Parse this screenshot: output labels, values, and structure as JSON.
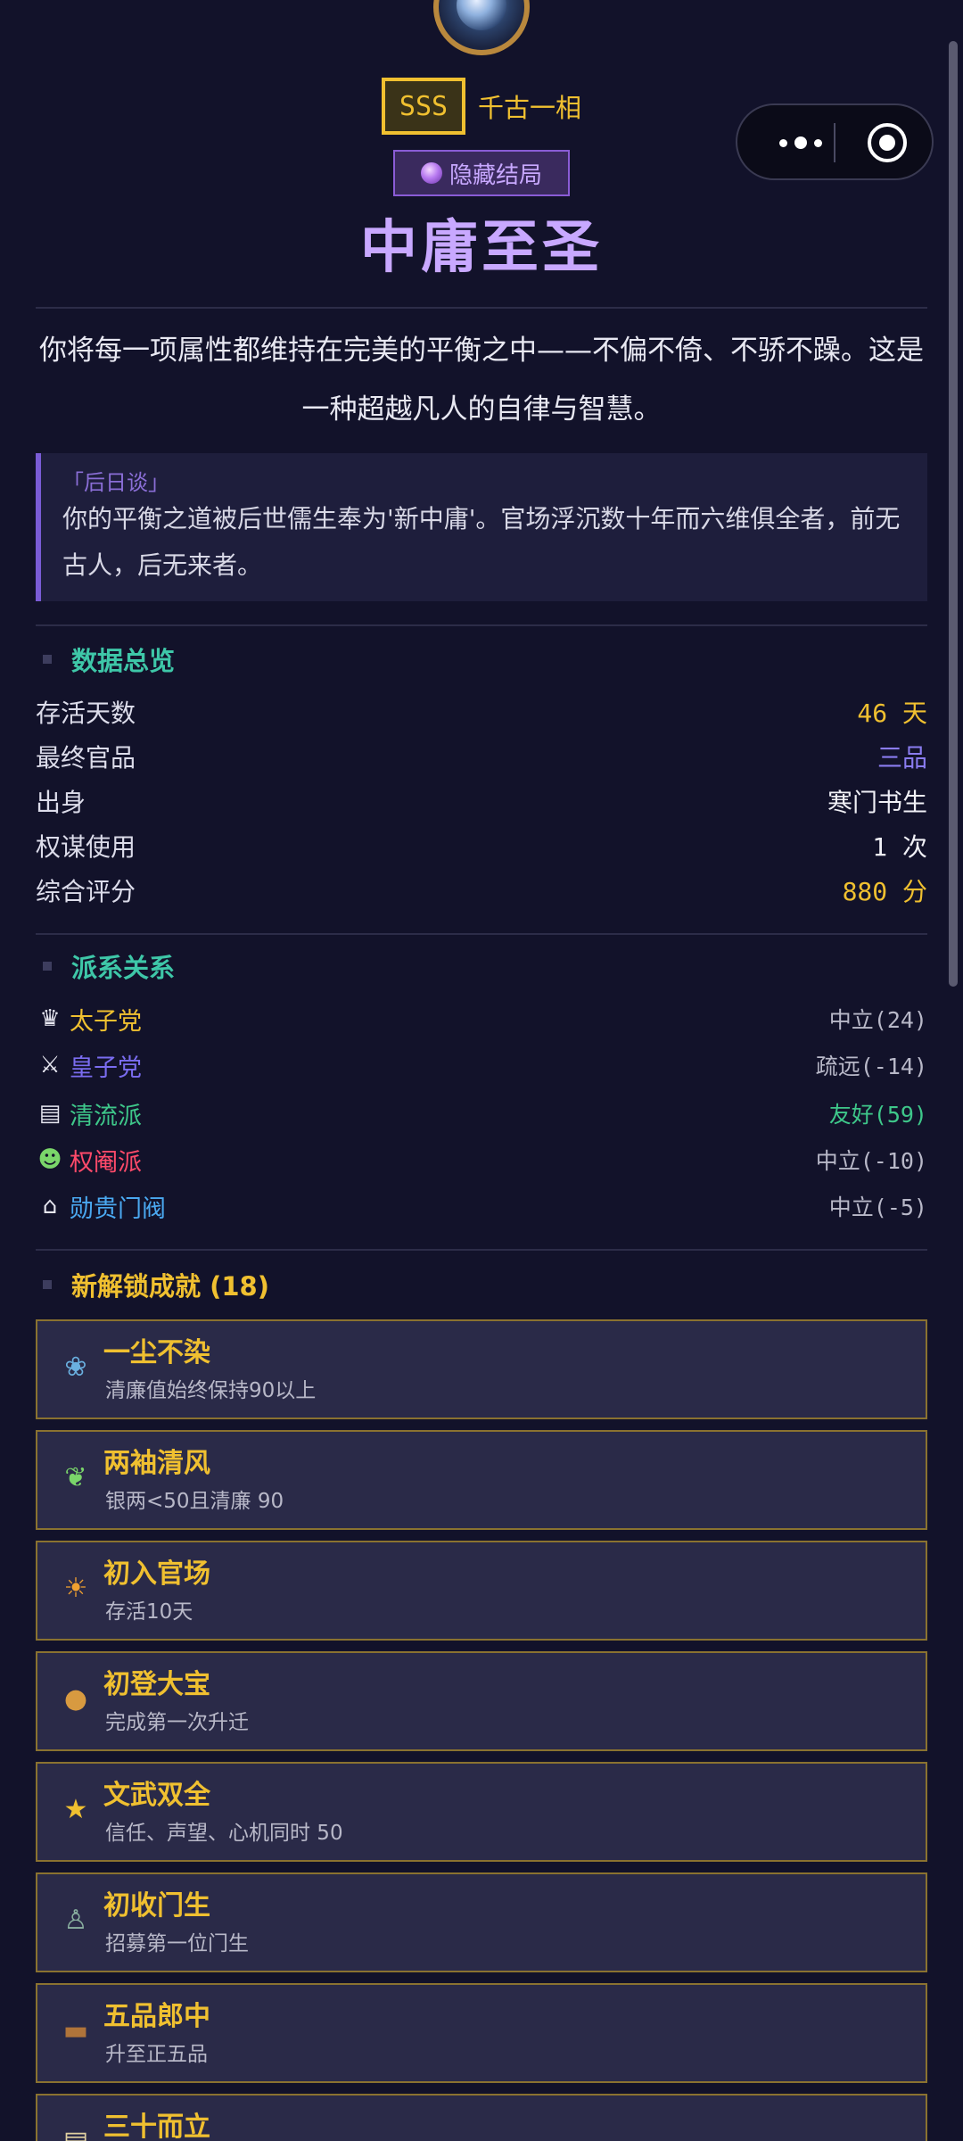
{
  "header": {
    "grade": "SSS",
    "grade_title": "千古一相",
    "ending_badge": "隐藏结局",
    "title": "中庸至圣",
    "description": "你将每一项属性都维持在完美的平衡之中——不偏不倚、不骄不躁。这是一种超越凡人的自律与智慧。",
    "epilogue_label": "「后日谈」",
    "epilogue_text": "你的平衡之道被后世儒生奉为'新中庸'。官场浮沉数十年而六维俱全者，前无古人，后无来者。"
  },
  "overview": {
    "title": "数据总览",
    "rows": [
      {
        "label": "存活天数",
        "value": "46 天"
      },
      {
        "label": "最终官品",
        "value": "三品"
      },
      {
        "label": "出身",
        "value": "寒门书生"
      },
      {
        "label": "权谋使用",
        "value": "1 次"
      },
      {
        "label": "综合评分",
        "value": "880 分"
      }
    ]
  },
  "factions": {
    "title": "派系关系",
    "items": [
      {
        "icon": "crown-icon",
        "name": "太子党",
        "status": "中立(24)",
        "name_color": "#f0c030",
        "status_color": "#b8b8c8"
      },
      {
        "icon": "crossed-swords-icon",
        "name": "皇子党",
        "status": "疏远(-14)",
        "name_color": "#7a6cf0",
        "status_color": "#b8b8c8"
      },
      {
        "icon": "books-icon",
        "name": "清流派",
        "status": "友好(59)",
        "name_color": "#3ec78a",
        "status_color": "#3ec78a"
      },
      {
        "icon": "masks-icon",
        "name": "权阉派",
        "status": "中立(-10)",
        "name_color": "#ff4a6a",
        "status_color": "#b8b8c8"
      },
      {
        "icon": "bank-icon",
        "name": "勋贵门阀",
        "status": "中立(-5)",
        "name_color": "#4aa8f0",
        "status_color": "#b8b8c8"
      }
    ]
  },
  "achievements": {
    "title": "新解锁成就 (18)",
    "items": [
      {
        "icon": "lotus-icon",
        "name": "一尘不染",
        "desc": "清廉值始终保持90以上"
      },
      {
        "icon": "leaf-wind-icon",
        "name": "两袖清风",
        "desc": "银两<50且清廉 90"
      },
      {
        "icon": "sunrise-icon",
        "name": "初入官场",
        "desc": "存活10天"
      },
      {
        "icon": "medal-icon",
        "name": "初登大宝",
        "desc": "完成第一次升迁"
      },
      {
        "icon": "star-icon",
        "name": "文武双全",
        "desc": "信任、声望、心机同时 50"
      },
      {
        "icon": "person-icon",
        "name": "初收门生",
        "desc": "招募第一位门生"
      },
      {
        "icon": "briefcase-icon",
        "name": "五品郎中",
        "desc": "升至正五品"
      },
      {
        "icon": "scroll-icon",
        "name": "三十而立",
        "desc": ""
      }
    ]
  },
  "colors": {
    "background": "#12122a",
    "gold": "#f0c030",
    "purple": "#c8a8ff",
    "teal": "#3ec7a8"
  }
}
